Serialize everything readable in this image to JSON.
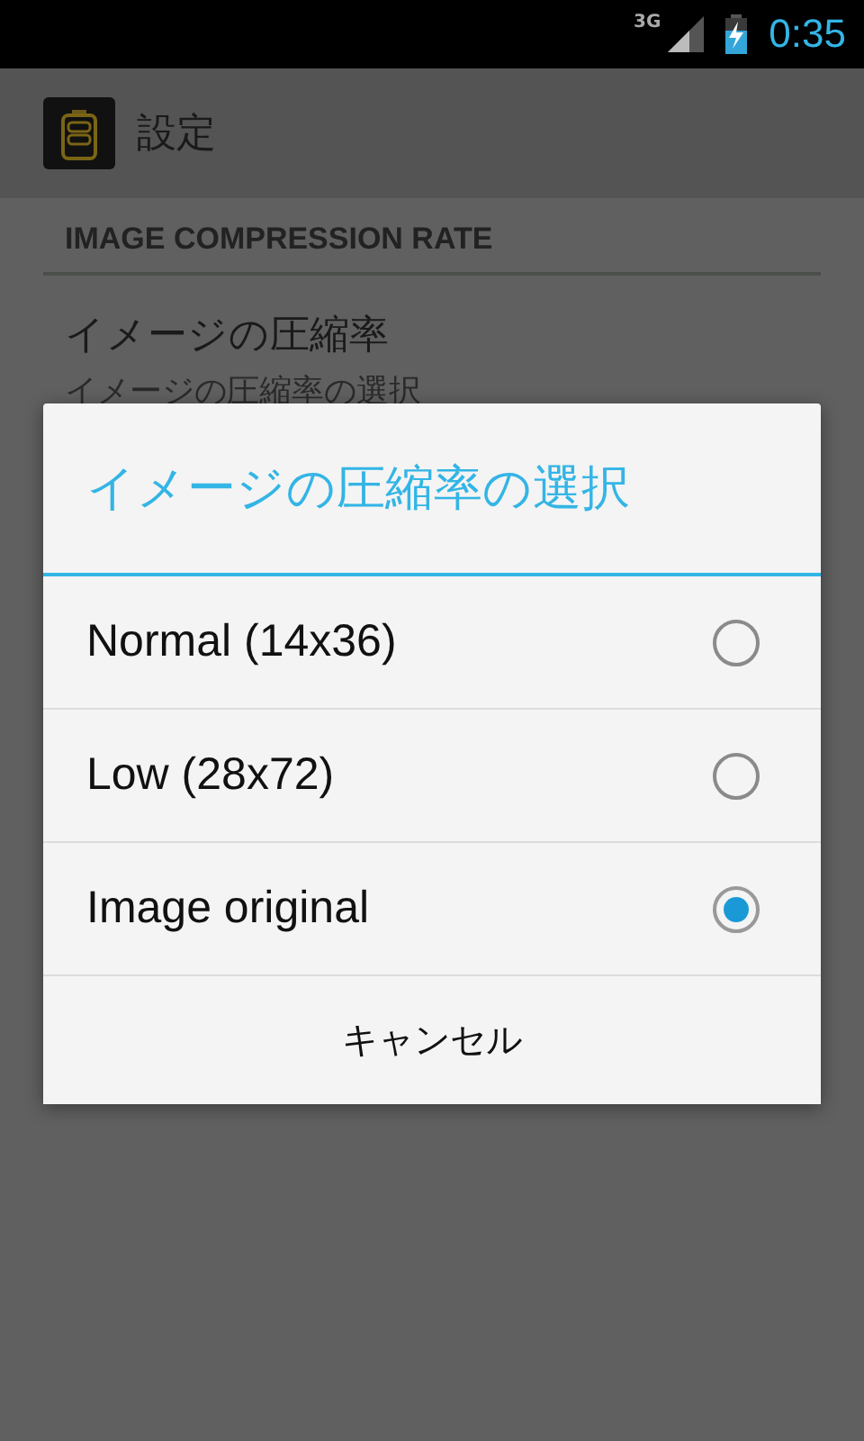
{
  "status_bar": {
    "network": "3G",
    "time": "0:35"
  },
  "action_bar": {
    "title": "設定"
  },
  "section_header": "IMAGE COMPRESSION RATE",
  "preference": {
    "title": "イメージの圧縮率",
    "summary": "イメージの圧縮率の選択"
  },
  "dialog": {
    "title": "イメージの圧縮率の選択",
    "options": [
      {
        "label": "Normal (14x36)",
        "selected": false
      },
      {
        "label": "Low (28x72)",
        "selected": false
      },
      {
        "label": "Image original",
        "selected": true
      }
    ],
    "cancel": "キャンセル"
  }
}
